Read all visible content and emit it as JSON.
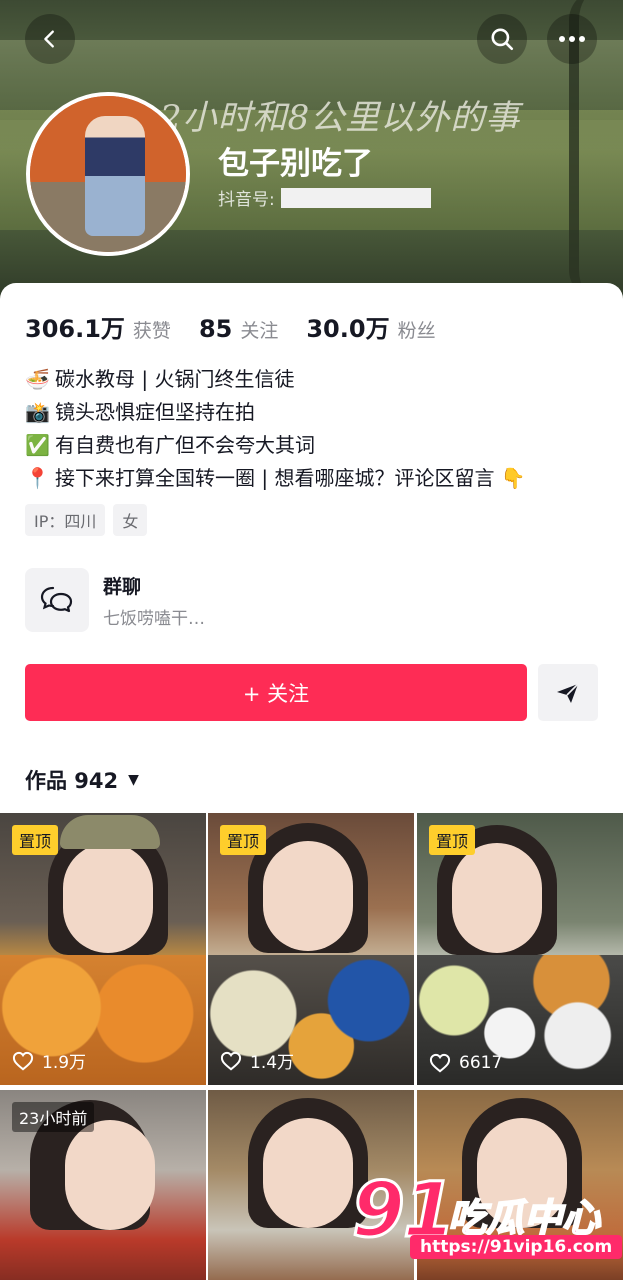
{
  "header": {
    "handwritten_text": "2小时和8公里以外的事",
    "nickname": "包子别吃了",
    "douyin_id_label": "抖音号:",
    "back_icon": "chevron-left-icon",
    "search_icon": "search-icon",
    "more_icon": "more-horizontal-icon"
  },
  "stats": [
    {
      "num": "306.1万",
      "label": "获赞"
    },
    {
      "num": "85",
      "label": "关注"
    },
    {
      "num": "30.0万",
      "label": "粉丝"
    }
  ],
  "bio": [
    {
      "emoji": "🍜",
      "text": "碳水教母 | 火锅门终生信徒"
    },
    {
      "emoji": "📸",
      "text": "镜头恐惧症但坚持在拍"
    },
    {
      "emoji": "✅",
      "text": "有自费也有广但不会夸大其词"
    },
    {
      "emoji": "📍",
      "text": "接下来打算全国转一圈 | 想看哪座城？评论区留言 👇"
    }
  ],
  "tags": [
    "IP：四川",
    "女"
  ],
  "group": {
    "title": "群聊",
    "subtitle": "七饭唠嗑干…"
  },
  "actions": {
    "follow_label": "+ 关注",
    "accent": "#fe2c55"
  },
  "works": {
    "label": "作品 942"
  },
  "tiles": [
    {
      "badge": "置顶",
      "likes": "1.9万"
    },
    {
      "badge": "置顶",
      "likes": "1.4万"
    },
    {
      "badge": "置顶",
      "likes": "6617"
    },
    {
      "badge": "23小时前",
      "likes": ""
    },
    {
      "badge": "",
      "likes": ""
    },
    {
      "badge": "",
      "likes": ""
    }
  ],
  "watermark": {
    "big": "91",
    "cn": "吃瓜中心",
    "url": "https://91vip16.com"
  }
}
